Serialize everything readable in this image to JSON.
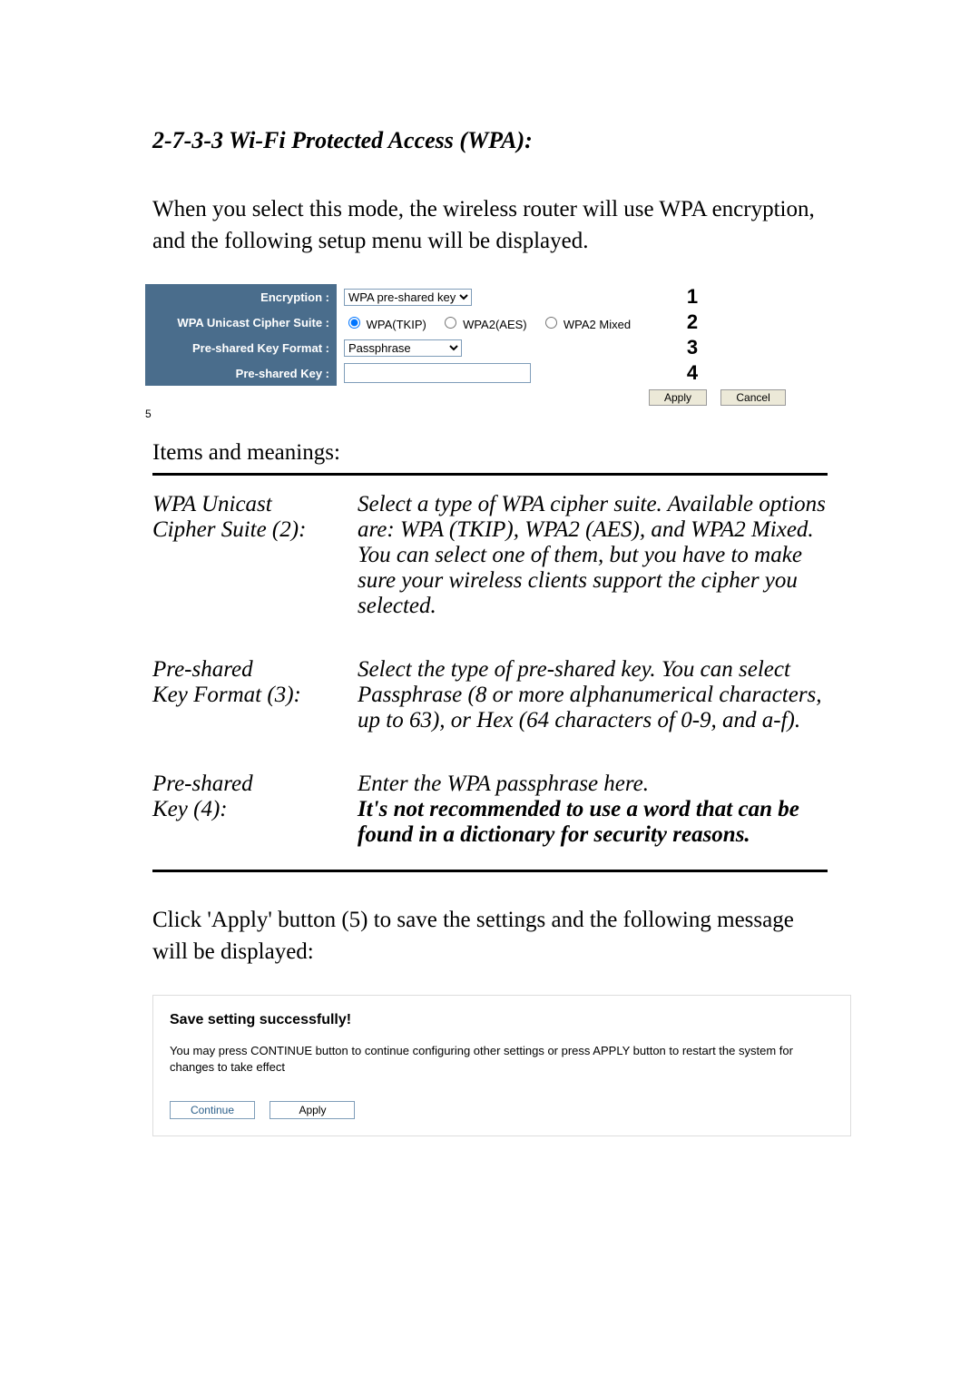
{
  "section_title": "2-7-3-3 Wi-Fi Protected Access (WPA):",
  "intro": "When you select this mode, the wireless router will use WPA encryption, and the following setup menu will be displayed.",
  "form": {
    "rows": [
      {
        "label": "Encryption :",
        "num": "1"
      },
      {
        "label": "WPA Unicast Cipher Suite :",
        "num": "2"
      },
      {
        "label": "Pre-shared Key Format :",
        "num": "3"
      },
      {
        "label": "Pre-shared Key :",
        "num": "4"
      }
    ],
    "encryption_selected": "WPA pre-shared key",
    "cipher_options": [
      "WPA(TKIP)",
      "WPA2(AES)",
      "WPA2 Mixed"
    ],
    "cipher_selected_index": 0,
    "keyformat_selected": "Passphrase",
    "preshared_key_value": "",
    "apply_label": "Apply",
    "cancel_label": "Cancel",
    "apply_num": "5"
  },
  "items_heading": "Items and meanings:",
  "defs": [
    {
      "term_line1": "WPA Unicast",
      "term_line2": "Cipher Suite (2):",
      "desc": "Select a type of WPA cipher suite.\nAvailable options are: WPA (TKIP), WPA2 (AES), and WPA2 Mixed. You can select one of them, but you have to make sure your wireless clients support the cipher you selected.",
      "desc_bold": ""
    },
    {
      "term_line1": "Pre-shared",
      "term_line2": "Key Format (3):",
      "desc": "Select the type of pre-shared key. You can select Passphrase (8 or more alphanumerical characters, up to 63), or Hex (64 characters of 0-9, and a-f).",
      "desc_bold": ""
    },
    {
      "term_line1": "Pre-shared",
      "term_line2": "Key (4):",
      "desc": "Enter the WPA passphrase here.",
      "desc_bold": "It's not recommended to use a word that can be found in a dictionary for security reasons."
    }
  ],
  "outro": "Click 'Apply' button (5) to save the settings and the following message will be displayed:",
  "savebox": {
    "title": "Save setting successfully!",
    "desc": "You may press CONTINUE button to continue configuring other settings or press APPLY button to restart the system for changes to take effect",
    "continue_label": "Continue",
    "apply_label": "Apply"
  }
}
